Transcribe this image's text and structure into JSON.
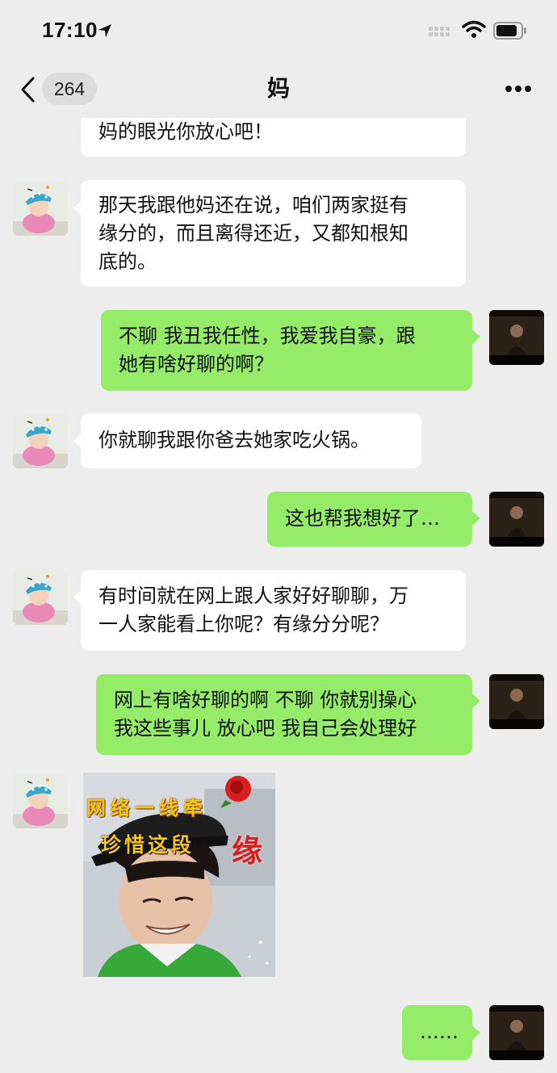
{
  "status_bar": {
    "time": "17:10",
    "icons": [
      "location-arrow-icon",
      "signal-icon",
      "wifi-icon",
      "battery-icon"
    ]
  },
  "nav": {
    "back_icon": "chevron-left-icon",
    "unread_count": "264",
    "title": "妈",
    "more_icon": "more-dots-icon"
  },
  "colors": {
    "background": "#ededed",
    "incoming_bubble": "#ffffff",
    "outgoing_bubble": "#95ec69"
  },
  "messages": [
    {
      "sender": "mom",
      "type": "text",
      "text": "妈的眼光你放心吧！"
    },
    {
      "sender": "mom",
      "type": "text",
      "text": "那天我跟他妈还在说，咱们两家挺有\n缘分的，而且离得还近，又都知根知\n底的。"
    },
    {
      "sender": "me",
      "type": "text",
      "text": "不聊 我丑我任性，我爱我自豪，跟\n她有啥好聊的啊？"
    },
    {
      "sender": "mom",
      "type": "text",
      "text": "你就聊我跟你爸去她家吃火锅。"
    },
    {
      "sender": "me",
      "type": "text",
      "text": "这也帮我想好了…"
    },
    {
      "sender": "mom",
      "type": "text",
      "text": "有时间就在网上跟人家好好聊聊，万\n一人家能看上你呢？有缘分分呢？"
    },
    {
      "sender": "me",
      "type": "text",
      "text": "网上有啥好聊的啊 不聊 你就别操心\n我这些事儿 放心吧 我自己会处理好"
    },
    {
      "sender": "mom",
      "type": "sticker",
      "caption_line1": "网络一线牵",
      "caption_line2": "珍惜这段",
      "caption_big": "缘"
    },
    {
      "sender": "me",
      "type": "text",
      "text": "……"
    }
  ]
}
